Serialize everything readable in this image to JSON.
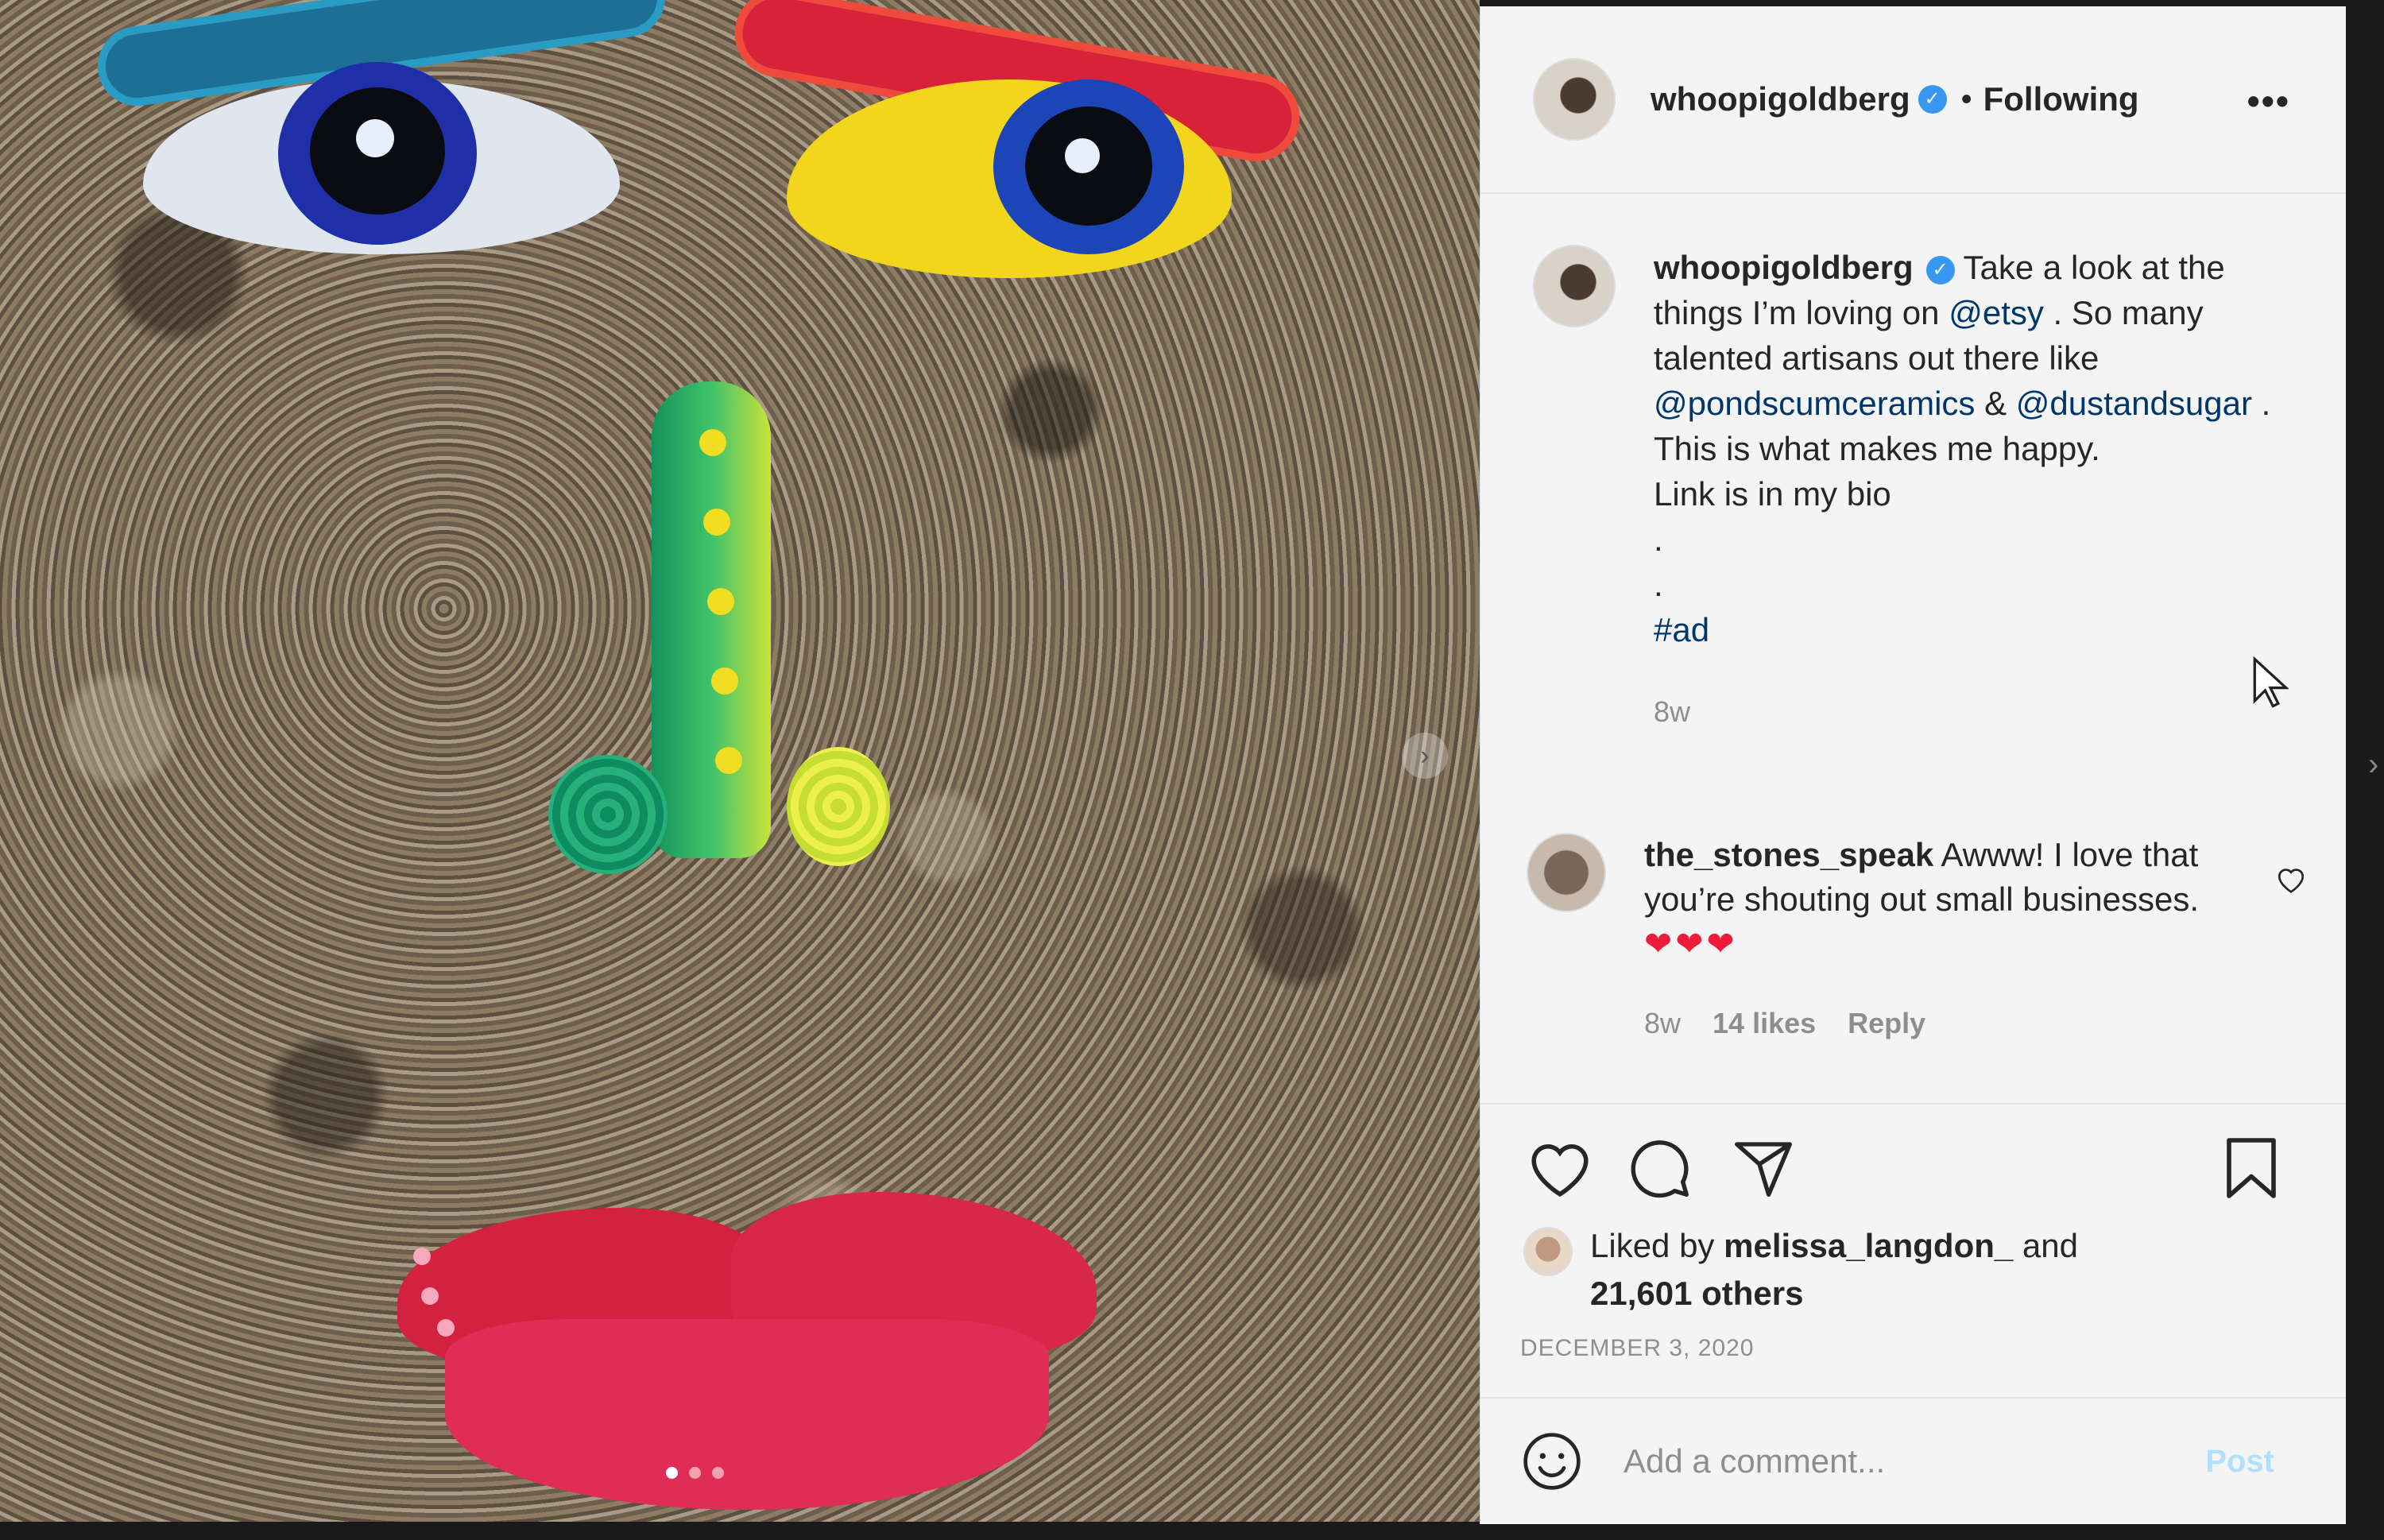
{
  "header": {
    "username": "whoopigoldberg",
    "separator": "•",
    "follow_status": "Following",
    "more_label": "•••"
  },
  "caption": {
    "username": "whoopigoldberg",
    "text_before_etsy": "Take a look at the things I’m loving on ",
    "mention_etsy": "@etsy",
    "text_after_etsy": " . So many talented artisans out there like ",
    "mention_pond": "@pondscumceramics",
    "amp": " & ",
    "mention_dust": "@dustandsugar",
    "text_end": " . This is what makes me happy.",
    "link_line": "Link is in my bio",
    "dot1": ".",
    "dot2": ".",
    "hashtag": "#ad",
    "time": "8w"
  },
  "comment": {
    "username": "the_stones_speak",
    "text": "Awww! I love that you’re shouting out small businesses.",
    "hearts": "❤❤❤",
    "time": "8w",
    "likes": "14 likes",
    "reply": "Reply"
  },
  "likes": {
    "prefix": "Liked by ",
    "user": "melissa_langdon_",
    "suffix": " and",
    "others": "21,601 others"
  },
  "post_date": "DECEMBER 3, 2020",
  "comment_box": {
    "placeholder": "Add a comment...",
    "post_label": "Post"
  },
  "carousel": {
    "count": 3,
    "active_index": 0,
    "next_label": "›"
  },
  "colors": {
    "link": "#00376b",
    "muted": "#8e8e8e",
    "verified": "#3897f0",
    "post_disabled": "#b2dffc",
    "heart_emoji": "#ed1c3a"
  },
  "icons": [
    "verified-badge-icon",
    "more-options-icon",
    "heart-icon",
    "comment-icon",
    "share-icon",
    "bookmark-icon",
    "emoji-icon",
    "comment-like-icon",
    "cursor-icon"
  ]
}
